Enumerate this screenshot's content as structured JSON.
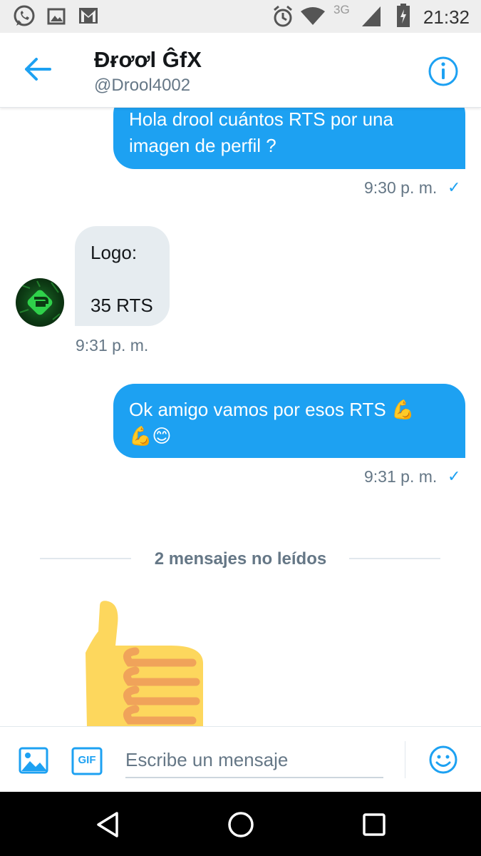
{
  "status_bar": {
    "time": "21:32",
    "network": "3G",
    "icons": [
      "whatsapp-icon",
      "gallery-icon",
      "gmail-icon",
      "alarm-icon",
      "wifi-icon",
      "signal-icon",
      "battery-icon"
    ]
  },
  "header": {
    "name": "Ɖɍơơl ĜfX",
    "handle": "@Drool4002",
    "back_icon": "arrow-left-icon",
    "info_icon": "info-icon"
  },
  "messages": [
    {
      "direction": "out",
      "lines": [
        "Hola drool cuántos RTS por una",
        "imagen de perfil ?"
      ],
      "time": "9:30 p. m.",
      "read": true
    },
    {
      "direction": "in",
      "lines": [
        "Logo:",
        "",
        "35 RTS"
      ],
      "time": "9:31 p. m."
    },
    {
      "direction": "out",
      "lines": [
        "Ok amigo vamos por esos RTS 💪",
        "💪😊"
      ],
      "time": "9:31 p. m.",
      "read": true
    }
  ],
  "unread_divider": "2 mensajes no leídos",
  "incoming_sticker": "thumbs-up-emoji",
  "composer": {
    "placeholder": "Escribe un mensaje",
    "gif_label": "GIF",
    "image_icon": "image-icon",
    "emoji_icon": "smiley-icon"
  },
  "nav_bar": {
    "icons": [
      "back-triangle-icon",
      "home-circle-icon",
      "recents-square-icon"
    ]
  },
  "colors": {
    "accent": "#1da1f2",
    "incoming_bubble": "#e6ecf0",
    "muted_text": "#657786"
  }
}
